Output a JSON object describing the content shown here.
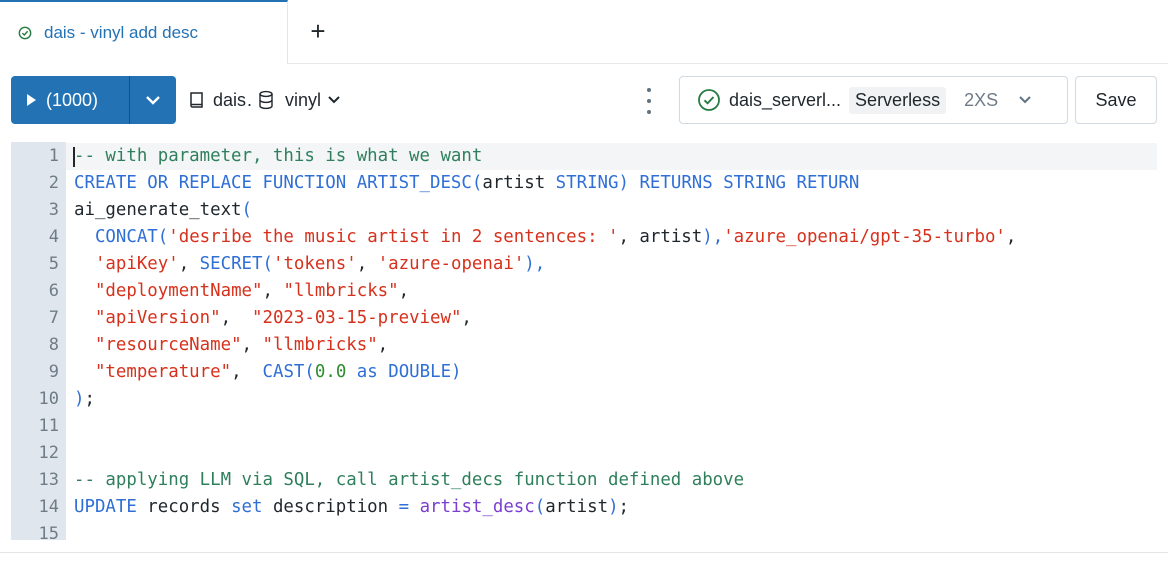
{
  "tab": {
    "title": "dais - vinyl add desc",
    "add_label": "+"
  },
  "toolbar": {
    "run_label": "(1000)",
    "catalog": "dais",
    "catalog_sep": ".",
    "database": "vinyl",
    "compute_name": "dais_serverl...",
    "compute_type": "Serverless",
    "compute_size": "2XS",
    "save_label": "Save"
  },
  "editor": {
    "lines": [
      {
        "n": "1",
        "segs": [
          {
            "t": "-- with parameter, this is what we want",
            "c": "c"
          }
        ]
      },
      {
        "n": "2",
        "segs": [
          {
            "t": "CREATE OR REPLACE FUNCTION ARTIST_DESC",
            "c": "k"
          },
          {
            "t": "(",
            "c": "k"
          },
          {
            "t": "artist ",
            "c": "p"
          },
          {
            "t": "STRING",
            "c": "k"
          },
          {
            "t": ") ",
            "c": "k"
          },
          {
            "t": "RETURNS STRING RETURN",
            "c": "k"
          }
        ]
      },
      {
        "n": "3",
        "segs": [
          {
            "t": "ai_generate_text",
            "c": "p"
          },
          {
            "t": "(",
            "c": "k"
          }
        ]
      },
      {
        "n": "4",
        "segs": [
          {
            "t": "  ",
            "c": "p"
          },
          {
            "t": "CONCAT",
            "c": "k"
          },
          {
            "t": "(",
            "c": "k"
          },
          {
            "t": "'desribe the music artist in 2 sentences: '",
            "c": "s"
          },
          {
            "t": ", artist",
            "c": "p"
          },
          {
            "t": "),",
            "c": "k"
          },
          {
            "t": "'azure_openai/gpt-35-turbo'",
            "c": "s"
          },
          {
            "t": ",",
            "c": "p"
          }
        ]
      },
      {
        "n": "5",
        "segs": [
          {
            "t": "  ",
            "c": "p"
          },
          {
            "t": "'apiKey'",
            "c": "s"
          },
          {
            "t": ", ",
            "c": "p"
          },
          {
            "t": "SECRET",
            "c": "k"
          },
          {
            "t": "(",
            "c": "k"
          },
          {
            "t": "'tokens'",
            "c": "s"
          },
          {
            "t": ", ",
            "c": "p"
          },
          {
            "t": "'azure-openai'",
            "c": "s"
          },
          {
            "t": "),",
            "c": "k"
          }
        ]
      },
      {
        "n": "6",
        "segs": [
          {
            "t": "  ",
            "c": "p"
          },
          {
            "t": "\"deploymentName\"",
            "c": "s"
          },
          {
            "t": ", ",
            "c": "p"
          },
          {
            "t": "\"llmbricks\"",
            "c": "s"
          },
          {
            "t": ",",
            "c": "p"
          }
        ]
      },
      {
        "n": "7",
        "segs": [
          {
            "t": "  ",
            "c": "p"
          },
          {
            "t": "\"apiVersion\"",
            "c": "s"
          },
          {
            "t": ",  ",
            "c": "p"
          },
          {
            "t": "\"2023-03-15-preview\"",
            "c": "s"
          },
          {
            "t": ",",
            "c": "p"
          }
        ]
      },
      {
        "n": "8",
        "segs": [
          {
            "t": "  ",
            "c": "p"
          },
          {
            "t": "\"resourceName\"",
            "c": "s"
          },
          {
            "t": ", ",
            "c": "p"
          },
          {
            "t": "\"llmbricks\"",
            "c": "s"
          },
          {
            "t": ",",
            "c": "p"
          }
        ]
      },
      {
        "n": "9",
        "segs": [
          {
            "t": "  ",
            "c": "p"
          },
          {
            "t": "\"temperature\"",
            "c": "s"
          },
          {
            "t": ",  ",
            "c": "p"
          },
          {
            "t": "CAST",
            "c": "k"
          },
          {
            "t": "(",
            "c": "k"
          },
          {
            "t": "0.0",
            "c": "n"
          },
          {
            "t": " ",
            "c": "p"
          },
          {
            "t": "as",
            "c": "k"
          },
          {
            "t": " ",
            "c": "p"
          },
          {
            "t": "DOUBLE",
            "c": "k"
          },
          {
            "t": ")",
            "c": "k"
          }
        ]
      },
      {
        "n": "10",
        "segs": [
          {
            "t": ")",
            "c": "k"
          },
          {
            "t": ";",
            "c": "p"
          }
        ]
      },
      {
        "n": "11",
        "segs": []
      },
      {
        "n": "12",
        "segs": []
      },
      {
        "n": "13",
        "segs": [
          {
            "t": "-- applying LLM via SQL, call artist_decs function defined above",
            "c": "c"
          }
        ]
      },
      {
        "n": "14",
        "segs": [
          {
            "t": "UPDATE",
            "c": "k"
          },
          {
            "t": " records ",
            "c": "p"
          },
          {
            "t": "set",
            "c": "k"
          },
          {
            "t": " description ",
            "c": "p"
          },
          {
            "t": "=",
            "c": "k"
          },
          {
            "t": " ",
            "c": "p"
          },
          {
            "t": "artist_desc",
            "c": "fn"
          },
          {
            "t": "(",
            "c": "k"
          },
          {
            "t": "artist",
            "c": "p"
          },
          {
            "t": ")",
            "c": "k"
          },
          {
            "t": ";",
            "c": "p"
          }
        ]
      },
      {
        "n": "15",
        "segs": []
      }
    ]
  }
}
